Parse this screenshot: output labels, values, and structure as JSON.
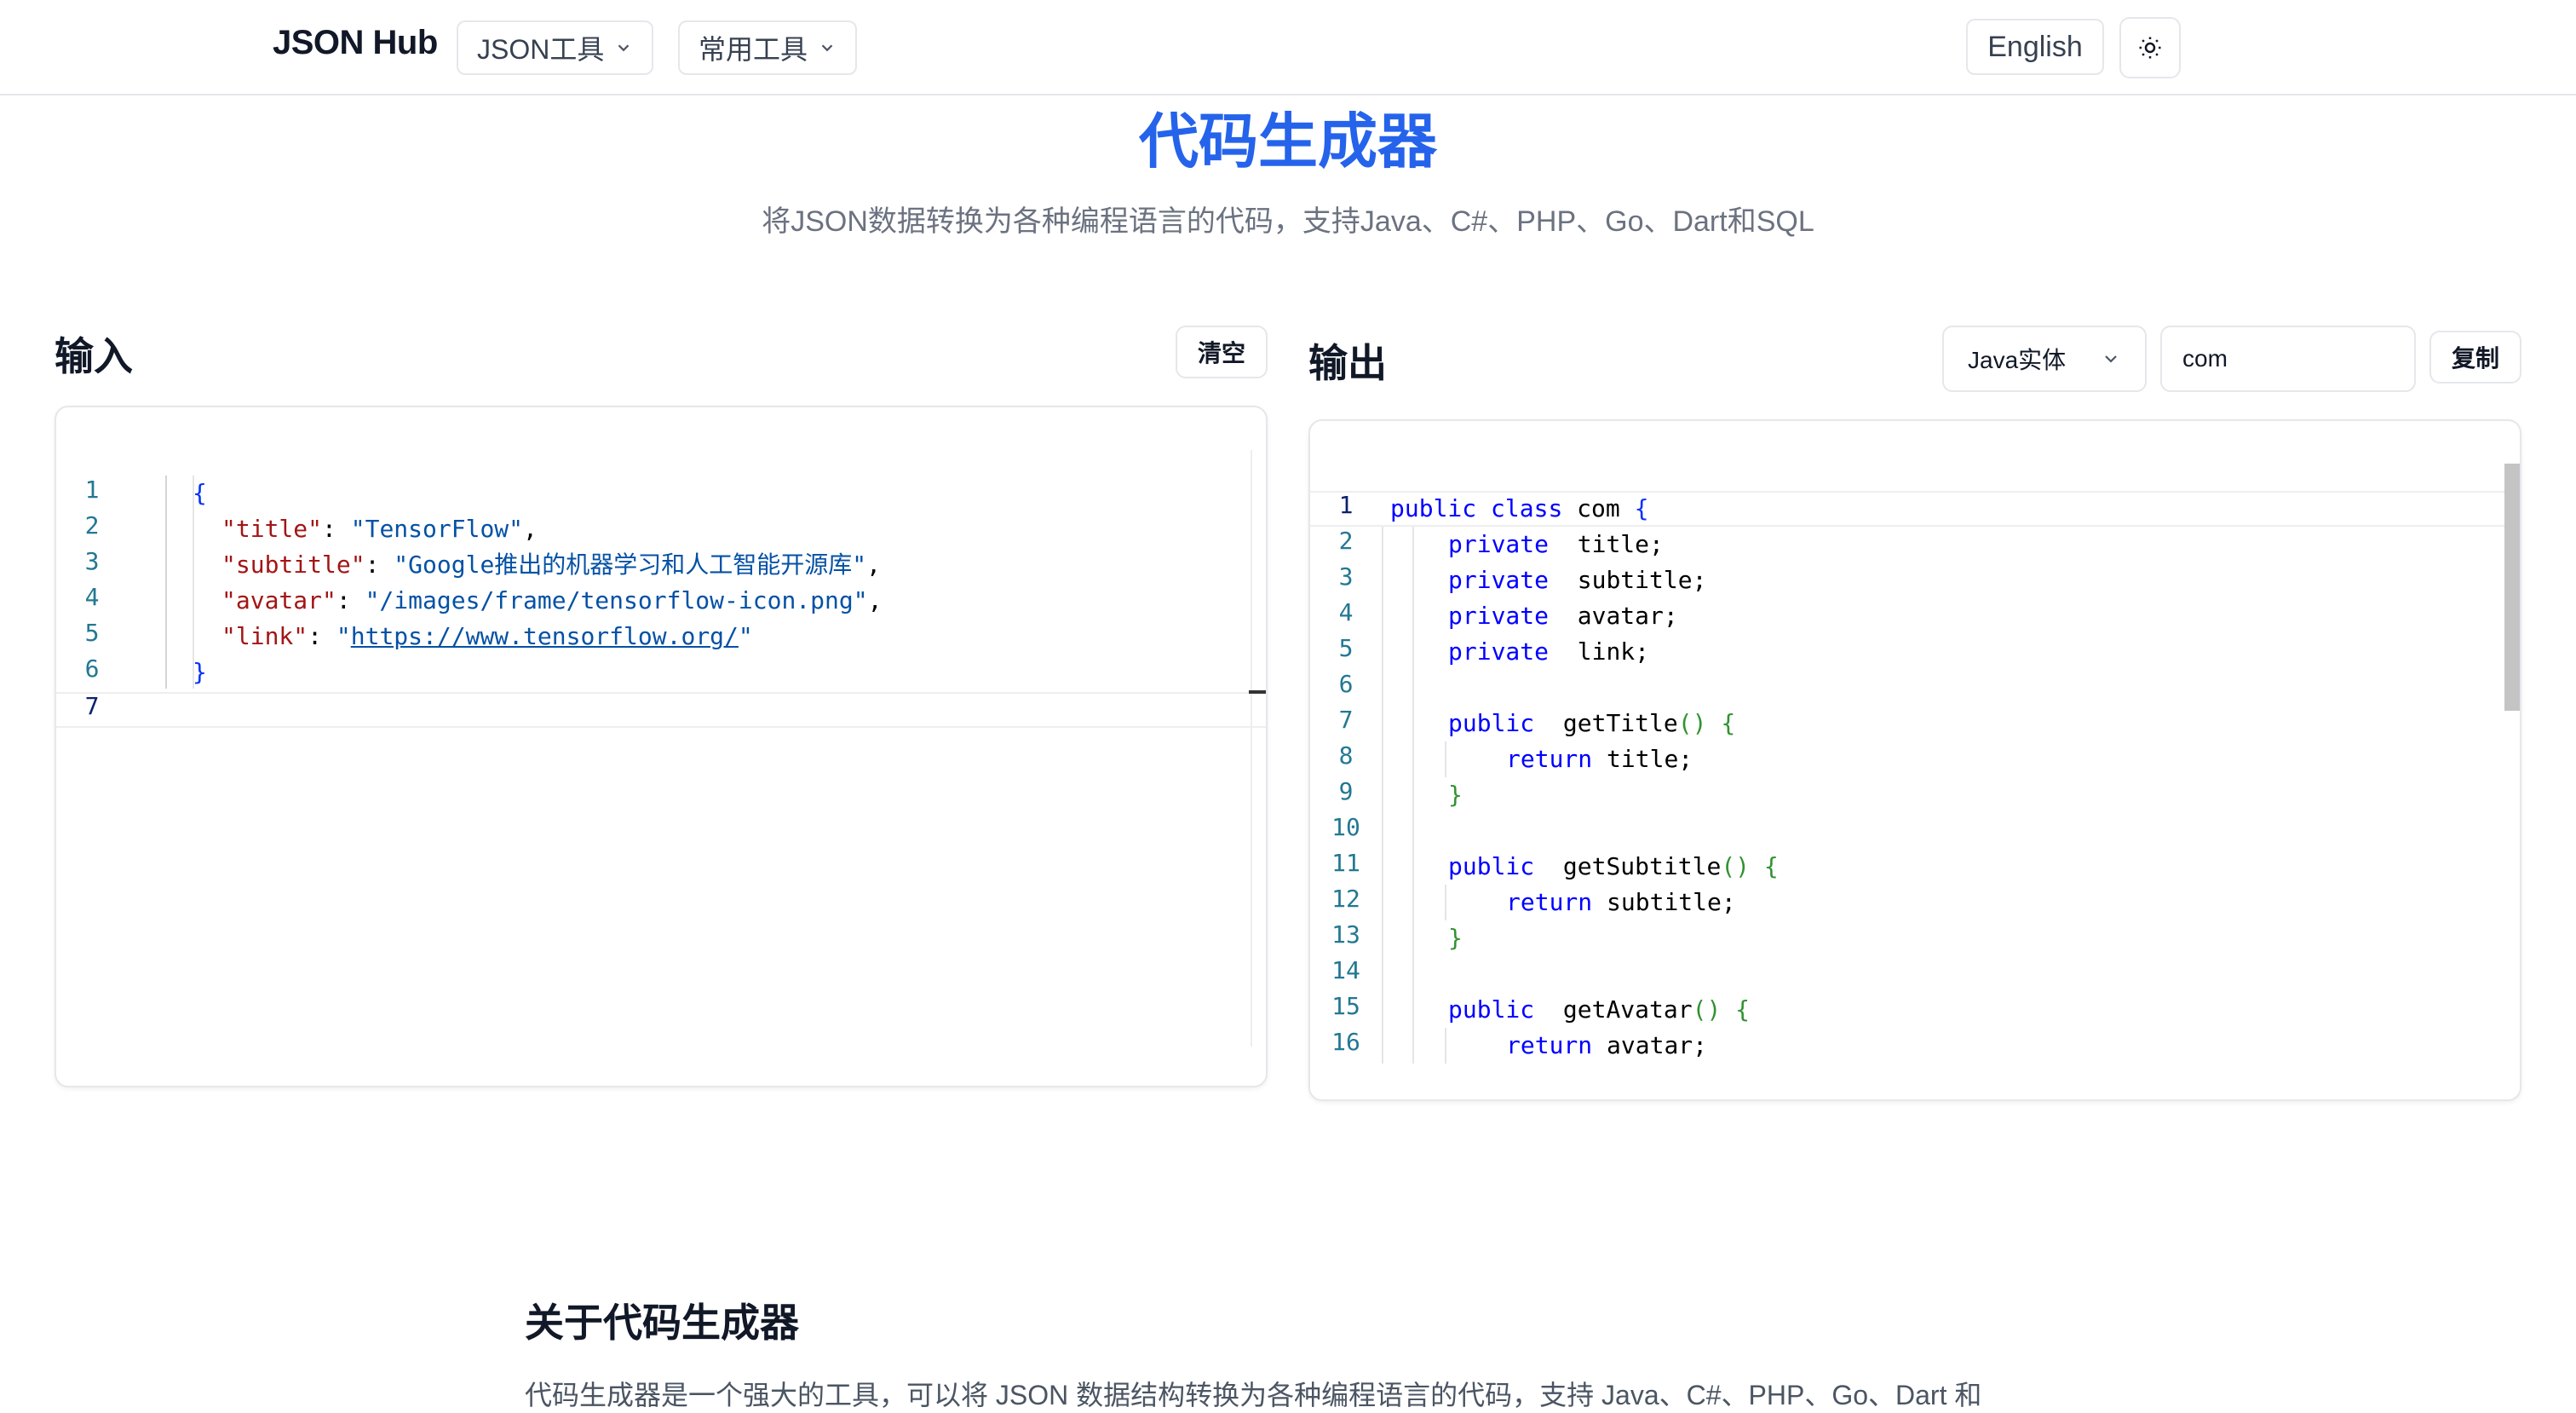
{
  "header": {
    "logo": "JSON Hub",
    "nav": [
      {
        "label": "JSON工具"
      },
      {
        "label": "常用工具"
      }
    ],
    "language": "English"
  },
  "page": {
    "title": "代码生成器",
    "subtitle": "将JSON数据转换为各种编程语言的代码，支持Java、C#、PHP、Go、Dart和SQL"
  },
  "input": {
    "heading": "输入",
    "clear_label": "清空",
    "lines": [
      "1",
      "2",
      "3",
      "4",
      "5",
      "6",
      "7"
    ]
  },
  "output": {
    "heading": "输出",
    "language_select": "Java实体",
    "class_name": "com",
    "copy_label": "复制",
    "lines": [
      "1",
      "2",
      "3",
      "4",
      "5",
      "6",
      "7",
      "8",
      "9",
      "10",
      "11",
      "12",
      "13",
      "14",
      "15",
      "16"
    ]
  },
  "about": {
    "heading": "关于代码生成器",
    "text": "代码生成器是一个强大的工具，可以将 JSON 数据结构转换为各种编程语言的代码，支持 Java、C#、PHP、Go、Dart 和"
  },
  "code_input": {
    "l1": "{",
    "k_title": "\"title\"",
    "v_title": "\"TensorFlow\"",
    "k_subtitle": "\"subtitle\"",
    "v_subtitle": "\"Google推出的机器学习和人工智能开源库\"",
    "k_avatar": "\"avatar\"",
    "v_avatar": "\"/images/frame/tensorflow-icon.png\"",
    "k_link": "\"link\"",
    "v_link": "https://www.tensorflow.org/",
    "l6": "}"
  },
  "code_output": {
    "public": "public",
    "class": "class",
    "private": "private",
    "return": "return",
    "name": "com",
    "f_title": "title;",
    "f_subtitle": "subtitle;",
    "f_avatar": "avatar;",
    "f_link": "link;",
    "m_title": "getTitle",
    "m_subtitle": "getSubtitle",
    "m_avatar": "getAvatar",
    "r_title": "title;",
    "r_subtitle": "subtitle;",
    "r_avatar": "avatar;"
  }
}
